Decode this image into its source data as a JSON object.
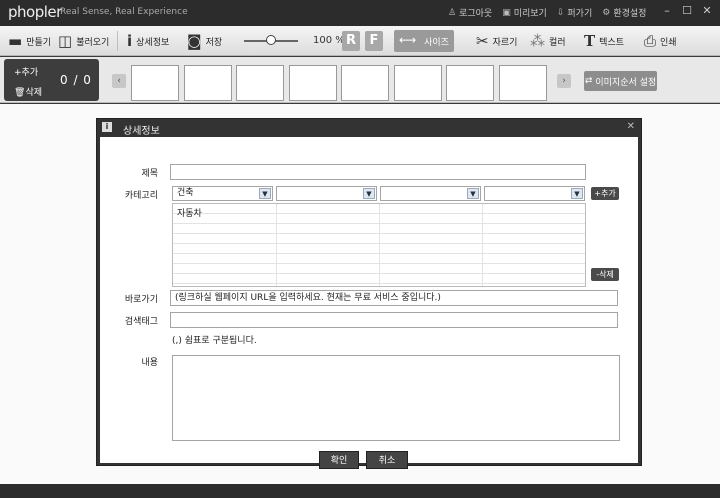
{
  "app": {
    "logo": "phopler",
    "tagline": "Real Sense, Real Experience",
    "links": [
      {
        "icon": "user-icon",
        "label": "로그아웃"
      },
      {
        "icon": "preview-icon",
        "label": "미리보기"
      },
      {
        "icon": "export-icon",
        "label": "퍼가기"
      },
      {
        "icon": "gear-icon",
        "label": "환경설정"
      }
    ]
  },
  "toolbar": {
    "make": "만들기",
    "open": "불러오기",
    "info": "상세정보",
    "save": "저장",
    "zoom": "100 %",
    "r": "R",
    "f": "F",
    "size": "사이즈",
    "crop": "자르기",
    "color": "컬러",
    "text": "텍스트",
    "print": "인쇄",
    "zoom_level": 0.5
  },
  "strip": {
    "add": "+추가",
    "delete": "삭제",
    "count": "0 / 0",
    "order": "이미지순서 설정",
    "thumb_count": 8
  },
  "dialog": {
    "title": "상세정보",
    "labels": {
      "subject": "제목",
      "category": "카테고리",
      "link": "바로가기",
      "tags": "검색태그",
      "content": "내용"
    },
    "subject_value": "",
    "categories": [
      "건축",
      "",
      "",
      ""
    ],
    "category_items": [
      "자동차"
    ],
    "add_btn": "+추가",
    "del_btn": "-삭제",
    "link_value": "(링크하실 웹페이지 URL을 입력하세요. 현재는 무료 서비스 중입니다.)",
    "tags_value": "",
    "tags_hint": "(,) 쉼표로 구분됩니다.",
    "content_value": "",
    "ok": "확인",
    "cancel": "취소"
  }
}
